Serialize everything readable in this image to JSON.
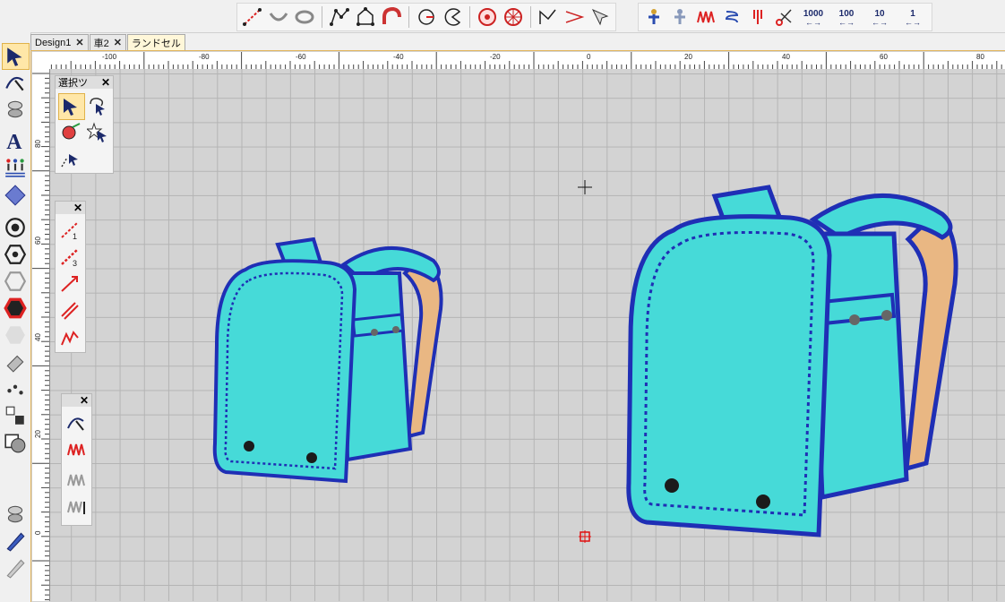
{
  "tabs": [
    {
      "label": "Design1",
      "active": false
    },
    {
      "label": "車2",
      "active": false
    },
    {
      "label": "ランドセル",
      "active": true
    }
  ],
  "tab_close_glyph": "✕",
  "ruler": {
    "h_labels": [
      "-100",
      "-80",
      "-60",
      "-40",
      "-20",
      "0",
      "20",
      "40",
      "60",
      "80"
    ],
    "v_labels": [
      "80",
      "60",
      "40",
      "20",
      "0"
    ]
  },
  "toolbar": {
    "number_buttons": [
      "1000",
      "100",
      "10",
      "1"
    ],
    "arrow_glyph": "←→"
  },
  "panels": {
    "select_title": "選択ツ",
    "close_glyph": "✕"
  },
  "colors": {
    "body": "#46dad8",
    "outline": "#1f2fb5",
    "strap": "#e9b783",
    "rivet": "#1b1b1b",
    "grid": "#b4b4b4",
    "canvas": "#d3d3d3"
  }
}
